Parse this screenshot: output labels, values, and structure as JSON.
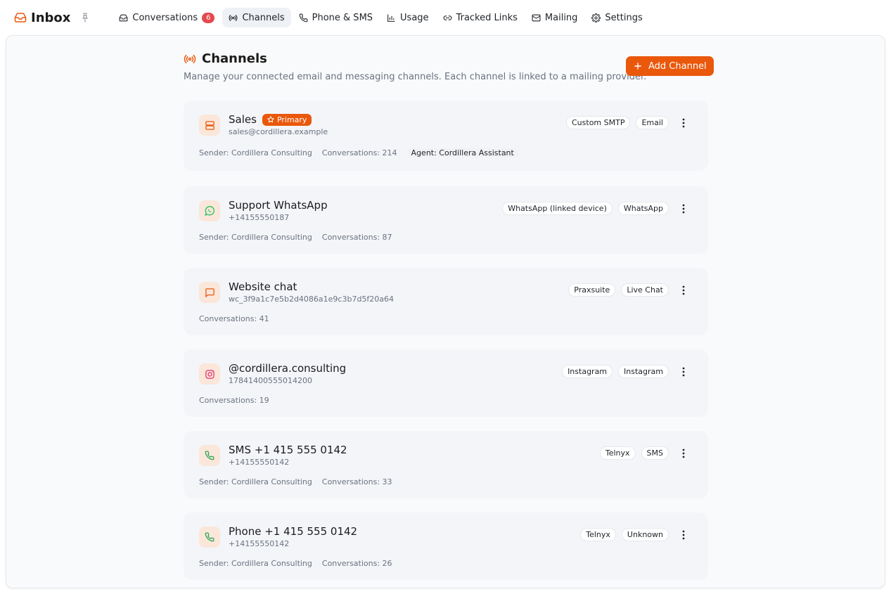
{
  "app": {
    "title": "Inbox"
  },
  "nav": [
    {
      "id": "conversations",
      "label": "Conversations",
      "badge": "6",
      "icon": "inbox-icon"
    },
    {
      "id": "channels",
      "label": "Channels",
      "icon": "radio-icon",
      "active": true
    },
    {
      "id": "phone",
      "label": "Phone & SMS",
      "icon": "phone-icon"
    },
    {
      "id": "usage",
      "label": "Usage",
      "icon": "bar-chart-icon"
    },
    {
      "id": "links",
      "label": "Tracked Links",
      "icon": "link-icon"
    },
    {
      "id": "mailing",
      "label": "Mailing",
      "icon": "mail-icon"
    },
    {
      "id": "settings",
      "label": "Settings",
      "icon": "gear-icon"
    }
  ],
  "page": {
    "title": "Channels",
    "subtitle": "Manage your connected email and messaging channels. Each channel is linked to a mailing provider.",
    "add_label": "Add Channel"
  },
  "channels": [
    {
      "name": "Sales",
      "primary": "Primary",
      "sub": "sales@cordillera.example",
      "icon": "server-icon",
      "tags": [
        "Custom SMTP",
        "Email"
      ],
      "sender": "Sender: Cordillera Consulting",
      "conversations": "Conversations: 214",
      "agent": "Agent: Cordillera Assistant"
    },
    {
      "name": "Support WhatsApp",
      "sub": "+14155550187",
      "icon": "whatsapp-icon",
      "tags": [
        "WhatsApp (linked device)",
        "WhatsApp"
      ],
      "sender": "Sender: Cordillera Consulting",
      "conversations": "Conversations: 87"
    },
    {
      "name": "Website chat",
      "sub": "wc_3f9a1c7e5b2d4086a1e9c3b7d5f20a64",
      "icon": "chat-icon",
      "tags": [
        "Praxsuite",
        "Live Chat"
      ],
      "conversations": "Conversations: 41"
    },
    {
      "name": "@cordillera.consulting",
      "sub": "17841400555014200",
      "icon": "instagram-icon",
      "tags": [
        "Instagram",
        "Instagram"
      ],
      "conversations": "Conversations: 19"
    },
    {
      "name": "SMS +1 415 555 0142",
      "sub": "+14155550142",
      "icon": "phone-icon",
      "tags": [
        "Telnyx",
        "SMS"
      ],
      "sender": "Sender: Cordillera Consulting",
      "conversations": "Conversations: 33"
    },
    {
      "name": "Phone +1 415 555 0142",
      "sub": "+14155550142",
      "icon": "phone-icon",
      "tags": [
        "Telnyx",
        "Unknown"
      ],
      "sender": "Sender: Cordillera Consulting",
      "conversations": "Conversations: 26"
    }
  ],
  "colors": {
    "accent": "#ea580c",
    "badge": "#e5484d",
    "whatsapp": "#22c55e",
    "instagram": "#e1306c"
  }
}
